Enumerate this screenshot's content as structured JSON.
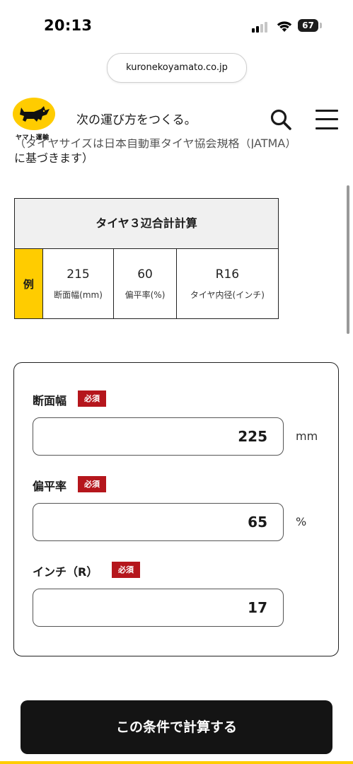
{
  "status": {
    "time": "20:13",
    "battery": "67"
  },
  "browser": {
    "url": "kuronekoyamato.co.jp"
  },
  "header": {
    "logo_text": "ヤマト運輸",
    "tagline": "次の運び方をつくる。"
  },
  "note": {
    "cut_line": "（タイヤサイズは日本自動車タイヤ協会規格（JATMA）",
    "line": "に基づきます）"
  },
  "example_table": {
    "title": "タイヤ３辺合計計算",
    "row_label": "例",
    "cells": [
      {
        "value": "215",
        "caption": "断面幅(mm)"
      },
      {
        "value": "60",
        "caption": "偏平率(%)"
      },
      {
        "value": "R16",
        "caption": "タイヤ内径(インチ)"
      }
    ]
  },
  "form": {
    "required_label": "必須",
    "fields": [
      {
        "label": "断面幅",
        "value": "225",
        "unit": "mm"
      },
      {
        "label": "偏平率",
        "value": "65",
        "unit": "%"
      },
      {
        "label": "インチ（R）",
        "value": "17",
        "unit": ""
      }
    ]
  },
  "submit_label": "この条件で計算する",
  "colors": {
    "brand_yellow": "#ffcc00",
    "required_red": "#b5161c",
    "button_black": "#141414"
  }
}
